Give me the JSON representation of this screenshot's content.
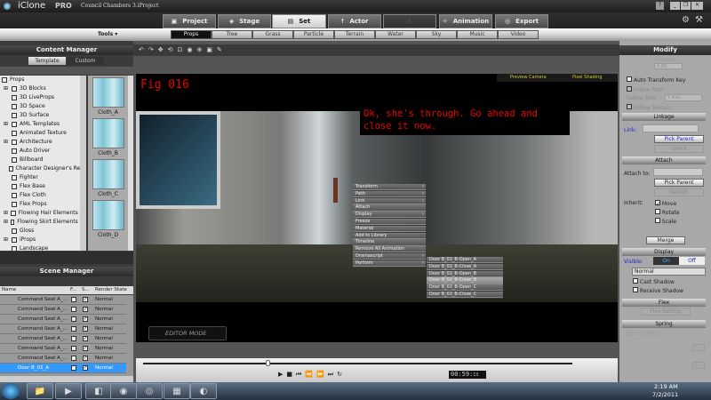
{
  "app": {
    "name": "iClone",
    "edition": "PRO",
    "project": "Council Chambers 3.iProject"
  },
  "window_controls": {
    "help": "?",
    "minimize": "_",
    "restore": "❐",
    "close": "✕"
  },
  "main_tabs": [
    {
      "label": "Project",
      "state": "normal"
    },
    {
      "label": "Stage",
      "state": "normal"
    },
    {
      "label": "Set",
      "state": "active"
    },
    {
      "label": "Actor",
      "state": "normal"
    },
    {
      "label": "",
      "state": "disabled"
    },
    {
      "label": "Animation",
      "state": "normal"
    },
    {
      "label": "Export",
      "state": "normal"
    }
  ],
  "tools_label": "Tools ▾",
  "sub_tabs": [
    "Props",
    "Tree",
    "Grass",
    "Particle",
    "Terrain",
    "Water",
    "Sky",
    "Music",
    "Video"
  ],
  "sub_tab_active": "Props",
  "content_manager": {
    "title": "Content Manager",
    "tabs": [
      "Template",
      "Custom"
    ],
    "active_tab": "Template",
    "tree": [
      {
        "label": "Props",
        "expand": false,
        "root": true
      },
      {
        "label": "3D Blocks",
        "expand": true
      },
      {
        "label": "3D LiveProps",
        "expand": false
      },
      {
        "label": "3D Space",
        "expand": false
      },
      {
        "label": "3D Surface",
        "expand": false
      },
      {
        "label": "AML Templates",
        "expand": true
      },
      {
        "label": "Animated Texture",
        "expand": false
      },
      {
        "label": "Architecture",
        "expand": true
      },
      {
        "label": "Auto Driver",
        "expand": false
      },
      {
        "label": "Billboard",
        "expand": false
      },
      {
        "label": "Character Designer's Reso",
        "expand": false
      },
      {
        "label": "Fighter",
        "expand": false
      },
      {
        "label": "Flex Base",
        "expand": false
      },
      {
        "label": "Flex Cloth",
        "expand": false
      },
      {
        "label": "Flex Props",
        "expand": false
      },
      {
        "label": "Flowing Hair Elements Vo",
        "expand": true
      },
      {
        "label": "Flowing Skirt Elements Vo",
        "expand": true
      },
      {
        "label": "Gloss",
        "expand": false
      },
      {
        "label": "iProps",
        "expand": true
      },
      {
        "label": "Landscape",
        "expand": false
      }
    ],
    "thumbnails": [
      "Cloth_A",
      "Cloth_B",
      "Cloth_C",
      "Cloth_D"
    ]
  },
  "scene_manager": {
    "title": "Scene Manager",
    "columns": [
      "Name",
      "F...",
      "S...",
      "Render State"
    ],
    "rows": [
      {
        "name": "Command Seat A_...",
        "show": true,
        "state": "Normal",
        "selected": false
      },
      {
        "name": "Command Seat A_...",
        "show": true,
        "state": "Normal",
        "selected": false
      },
      {
        "name": "Command Seat A_...",
        "show": true,
        "state": "Normal",
        "selected": false
      },
      {
        "name": "Command Seat A_...",
        "show": true,
        "state": "Normal",
        "selected": false
      },
      {
        "name": "Command Seat A_...",
        "show": true,
        "state": "Normal",
        "selected": false
      },
      {
        "name": "Command Seat A_...",
        "show": true,
        "state": "Normal",
        "selected": false
      },
      {
        "name": "Command Seat A_...",
        "show": true,
        "state": "Normal",
        "selected": false
      },
      {
        "name": "Door B_02_A",
        "show": true,
        "state": "Normal",
        "selected": true
      }
    ]
  },
  "viewport": {
    "preview_camera": "Preview Camera",
    "shading": "Pixel Shading",
    "fig_label": "Fig 016",
    "caption": "Ok, she's through.  Go ahead and close it now.",
    "editor_mode": "EDITOR MODE"
  },
  "context_menu": {
    "items": [
      {
        "label": "Transform",
        "sub": true
      },
      {
        "label": "Path",
        "sub": true
      },
      {
        "label": "Link",
        "sub": true
      },
      {
        "label": "Attach",
        "sub": false
      },
      {
        "label": "Display",
        "sub": true
      },
      {
        "label": "Freeze",
        "sub": false
      },
      {
        "label": "Material",
        "sub": false
      },
      {
        "label": "Add to Library",
        "sub": false
      },
      {
        "label": "Timeline",
        "sub": false
      },
      {
        "label": "Remove All Animation",
        "sub": false
      },
      {
        "label": "Dramascript",
        "sub": true
      },
      {
        "label": "Perform",
        "sub": true
      }
    ],
    "submenu": [
      "Door B_02_B-Open_A",
      "Door B_02_B-Close_A",
      "Door B_02_B-Open_B",
      "Door B_02_B-Close_B",
      "Door B_02_B-Open_C",
      "Door B_02_B-Close_C"
    ],
    "submenu_highlight": "Door B_02_B-Close_B"
  },
  "timeline": {
    "time": "00:59:",
    "frame": "13",
    "progress": 0.29
  },
  "modify": {
    "title": "Modify",
    "position_label": "Position",
    "position_value": "0.00",
    "auto_transform_key": "Auto Transform Key",
    "follow_path": "Follow Path",
    "follow_axis_label": "Follow Axis",
    "follow_axis_value": "Y Axis",
    "follow_terrain": "Follow Terrain",
    "linkage": "Linkage",
    "link_label": "Link:",
    "pick_parent": "Pick Parent",
    "unlink": "Unlink",
    "attach": "Attach",
    "attach_to": "Attach to:",
    "detach": "Detach",
    "inherit": "Inherit:",
    "inherit_items": [
      "Move",
      "Rotate",
      "Scale"
    ],
    "merge": "Merge",
    "display": "Display",
    "visible": "Visible:",
    "on": "On",
    "off": "Off",
    "render_mode": "Normal",
    "cast_shadow": "Cast Shadow",
    "receive_shadow": "Receive Shadow",
    "flex": "Flex",
    "flex_setting": "Flex Setting",
    "spring": "Spring",
    "spring_effect": "Spring Effect",
    "spring_value1": "6",
    "spring_value2": "6"
  },
  "taskbar": {
    "time": "2:19 AM",
    "date": "7/2/2011"
  }
}
